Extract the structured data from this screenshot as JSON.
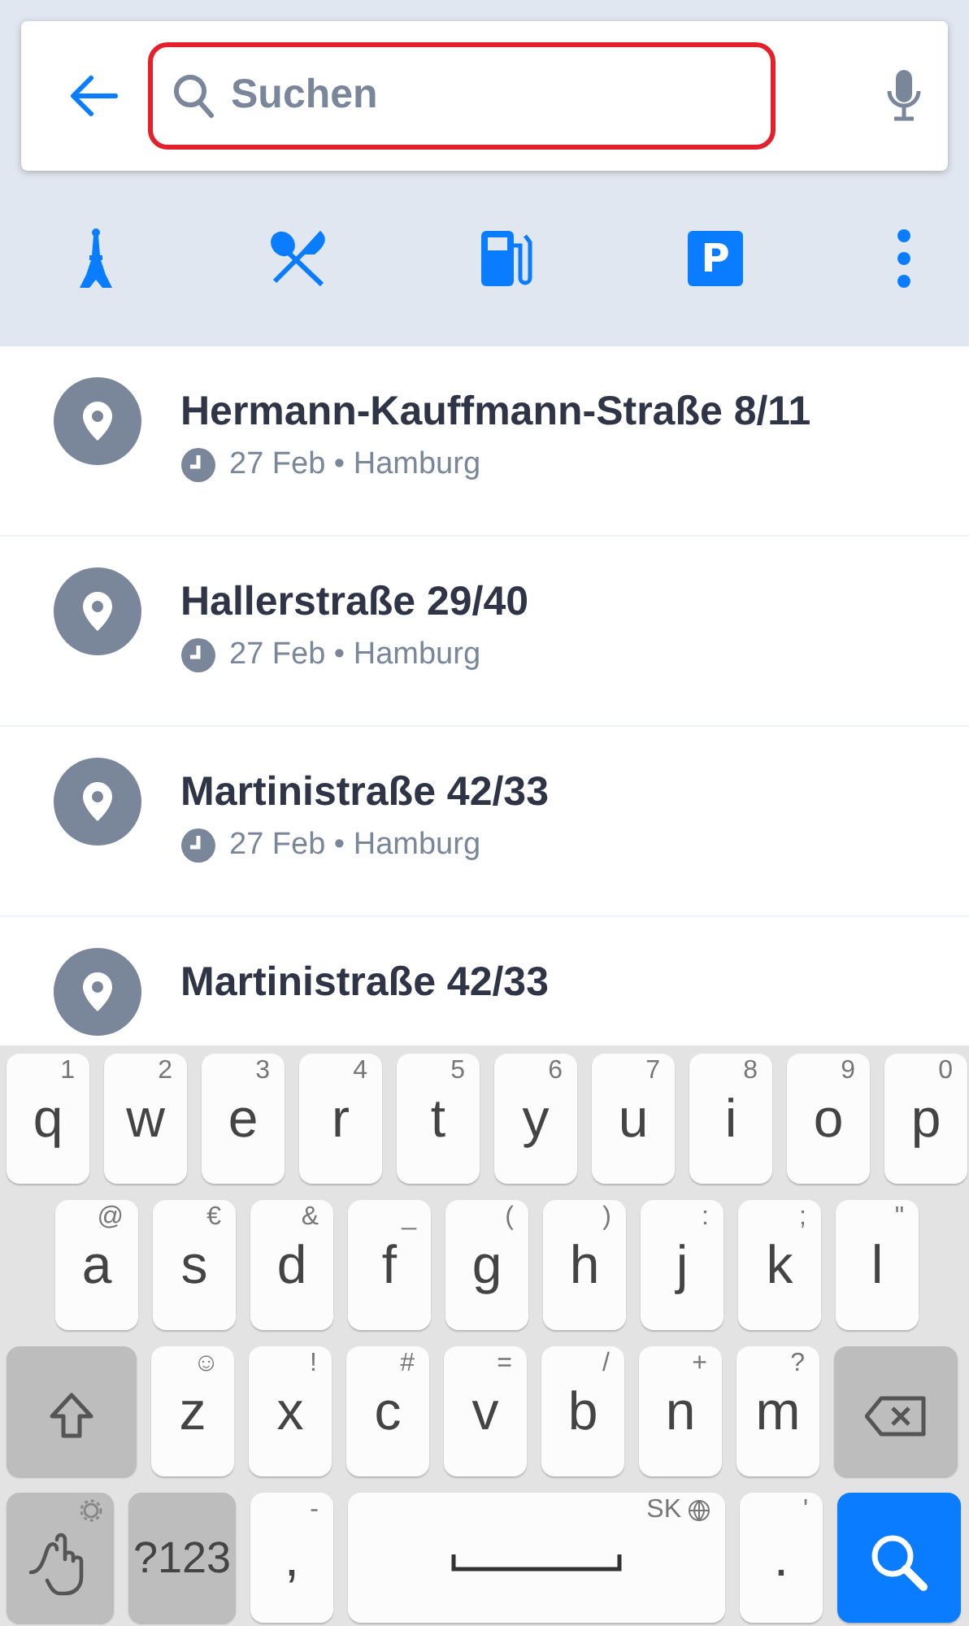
{
  "search_bar": {
    "placeholder": "Suchen",
    "focused": true
  },
  "categories": [
    {
      "kind": "sights"
    },
    {
      "kind": "food"
    },
    {
      "kind": "fuel"
    },
    {
      "kind": "parking",
      "label": "P"
    },
    {
      "kind": "more"
    }
  ],
  "recent": [
    {
      "title": "Hermann-Kauffmann-Straße 8/11",
      "subtitle": "27 Feb • Hamburg"
    },
    {
      "title": "Hallerstraße 29/40",
      "subtitle": "27 Feb • Hamburg"
    },
    {
      "title": "Martinistraße 42/33",
      "subtitle": "27 Feb • Hamburg"
    },
    {
      "title": "Martinistraße 42/33"
    }
  ],
  "keyboard": [
    [
      {
        "kind": "char",
        "label": "q",
        "hint": "1"
      },
      {
        "kind": "char",
        "label": "w",
        "hint": "2"
      },
      {
        "kind": "char",
        "label": "e",
        "hint": "3"
      },
      {
        "kind": "char",
        "label": "r",
        "hint": "4"
      },
      {
        "kind": "char",
        "label": "t",
        "hint": "5"
      },
      {
        "kind": "char",
        "label": "y",
        "hint": "6"
      },
      {
        "kind": "char",
        "label": "u",
        "hint": "7"
      },
      {
        "kind": "char",
        "label": "i",
        "hint": "8"
      },
      {
        "kind": "char",
        "label": "o",
        "hint": "9"
      },
      {
        "kind": "char",
        "label": "p",
        "hint": "0"
      }
    ],
    [
      {
        "kind": "char",
        "label": "a",
        "hint": "@"
      },
      {
        "kind": "char",
        "label": "s",
        "hint": "€"
      },
      {
        "kind": "char",
        "label": "d",
        "hint": "&"
      },
      {
        "kind": "char",
        "label": "f",
        "hint": "_"
      },
      {
        "kind": "char",
        "label": "g",
        "hint": "("
      },
      {
        "kind": "char",
        "label": "h",
        "hint": ")"
      },
      {
        "kind": "char",
        "label": "j",
        "hint": ":"
      },
      {
        "kind": "char",
        "label": "k",
        "hint": ";"
      },
      {
        "kind": "char",
        "label": "l",
        "hint": "\""
      }
    ],
    [
      {
        "kind": "shift"
      },
      {
        "kind": "char",
        "label": "z",
        "hint": "☺"
      },
      {
        "kind": "char",
        "label": "x",
        "hint": "!"
      },
      {
        "kind": "char",
        "label": "c",
        "hint": "#"
      },
      {
        "kind": "char",
        "label": "v",
        "hint": "="
      },
      {
        "kind": "char",
        "label": "b",
        "hint": "/"
      },
      {
        "kind": "char",
        "label": "n",
        "hint": "+"
      },
      {
        "kind": "char",
        "label": "m",
        "hint": "?"
      },
      {
        "kind": "backspace"
      }
    ],
    [
      {
        "kind": "gesture"
      },
      {
        "kind": "symbols",
        "label": "?123"
      },
      {
        "kind": "char",
        "label": ",",
        "hint": "-"
      },
      {
        "kind": "space",
        "hint": "SK"
      },
      {
        "kind": "char",
        "label": ".",
        "hint": "'"
      },
      {
        "kind": "search"
      }
    ]
  ]
}
